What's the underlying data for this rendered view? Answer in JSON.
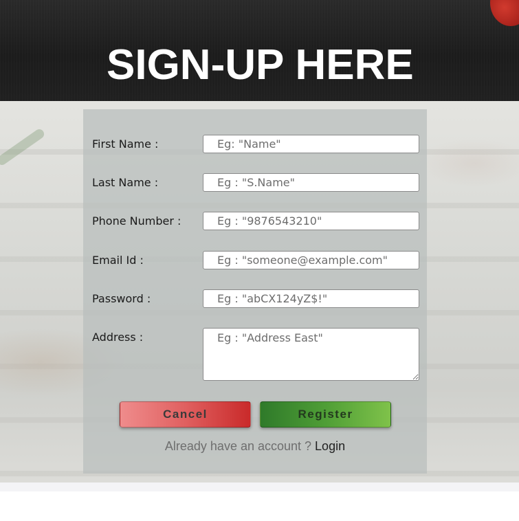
{
  "header": {
    "title": "SIGN-UP HERE"
  },
  "form": {
    "fields": [
      {
        "label": "First Name :",
        "placeholder": "Eg: \"Name\""
      },
      {
        "label": "Last Name :",
        "placeholder": "Eg : \"S.Name\""
      },
      {
        "label": "Phone Number :",
        "placeholder": "Eg : \"9876543210\""
      },
      {
        "label": "Email Id :",
        "placeholder": "Eg : \"someone@example.com\""
      },
      {
        "label": "Password :",
        "placeholder": "Eg : \"abCX124yZ$!\""
      },
      {
        "label": "Address :",
        "placeholder": "Eg : \"Address East\""
      }
    ],
    "cancel_label": "Cancel",
    "register_label": "Register",
    "account_question": "Already have an account ? ",
    "login_label": "Login"
  },
  "colors": {
    "cancel_button": "#e06060",
    "register_button": "#4f9e36",
    "header_background": "#1c1c1c"
  }
}
